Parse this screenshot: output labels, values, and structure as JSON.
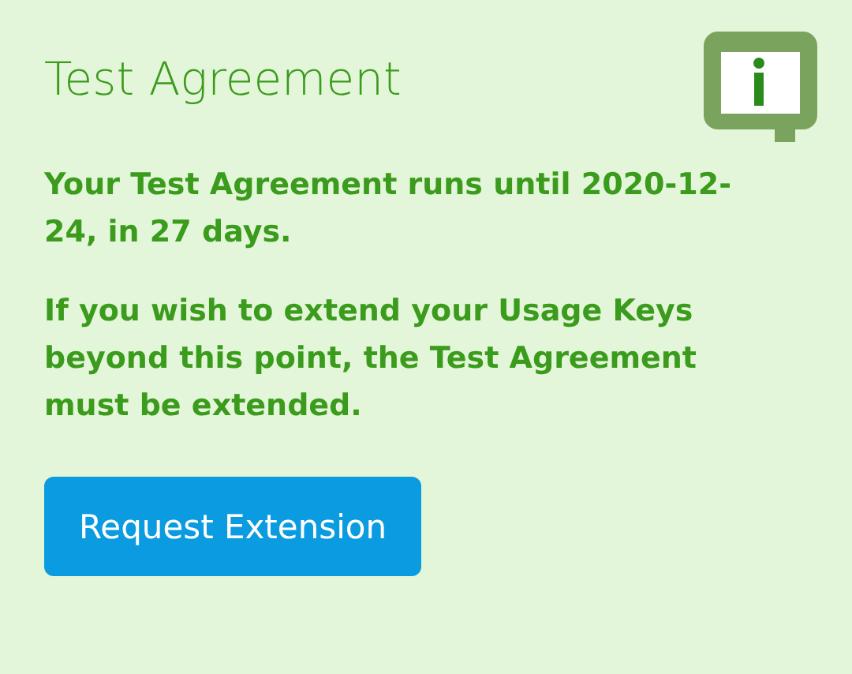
{
  "title": "Test Agreement",
  "paragraphs": [
    "Your Test Agreement runs until 2020-12-24, in 27 days.",
    "If you wish to extend your Usage Keys beyond this point, the Test Agreement must be extended."
  ],
  "button": "Request Extension"
}
